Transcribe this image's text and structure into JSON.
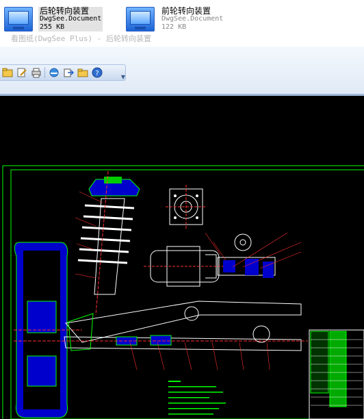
{
  "files": [
    {
      "name": "后轮转向装置",
      "type": "DwgSee.Document",
      "size": "255 KB",
      "selected": true,
      "icon": "document-icon"
    },
    {
      "name": "前轮转向装置",
      "type": "DwgSee.Document",
      "size": "122 KB",
      "selected": false,
      "icon": "document-icon"
    }
  ],
  "window": {
    "title": "看图纸(DwgSee Plus) - 后轮转向装置"
  },
  "toolbar": {
    "icons": [
      "open-icon",
      "edit-icon",
      "print-icon",
      "ie-icon",
      "export-icon",
      "folder-icon",
      "help-icon",
      "toolbar-options-icon"
    ]
  },
  "colors": {
    "canvas": "#000000",
    "drawing_lines": "#00ff00",
    "parts_fill": "#0000cc",
    "annotation": "#ff0000",
    "toolbar": "#dfe9f6"
  }
}
